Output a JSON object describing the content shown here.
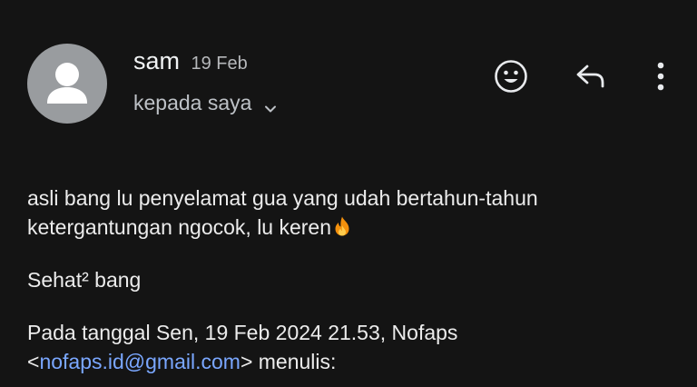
{
  "header": {
    "sender_name": "sam",
    "date": "19 Feb",
    "recipient_label": "kepada saya",
    "icons": {
      "avatar": "person-icon",
      "expand": "chevron-down-icon",
      "emoji": "emoji-icon",
      "reply": "reply-icon",
      "more": "more-vert-icon"
    }
  },
  "message": {
    "line1": "asli bang lu penyelamat gua yang udah bertahun-tahun",
    "line2": "ketergantungan ngocok, lu keren",
    "emoji": "fire-icon",
    "line3": "Sehat² bang",
    "quote_line1": "Pada tanggal Sen, 19 Feb 2024 21.53, Nofaps",
    "quote_open": "<",
    "quote_email": "nofaps.id@gmail.com",
    "quote_close": "> menulis:"
  },
  "colors": {
    "background": "#141414",
    "text": "#ececec",
    "secondary": "#bdc1c6",
    "link": "#7aa7ff",
    "avatar_bg": "#999c9f"
  }
}
